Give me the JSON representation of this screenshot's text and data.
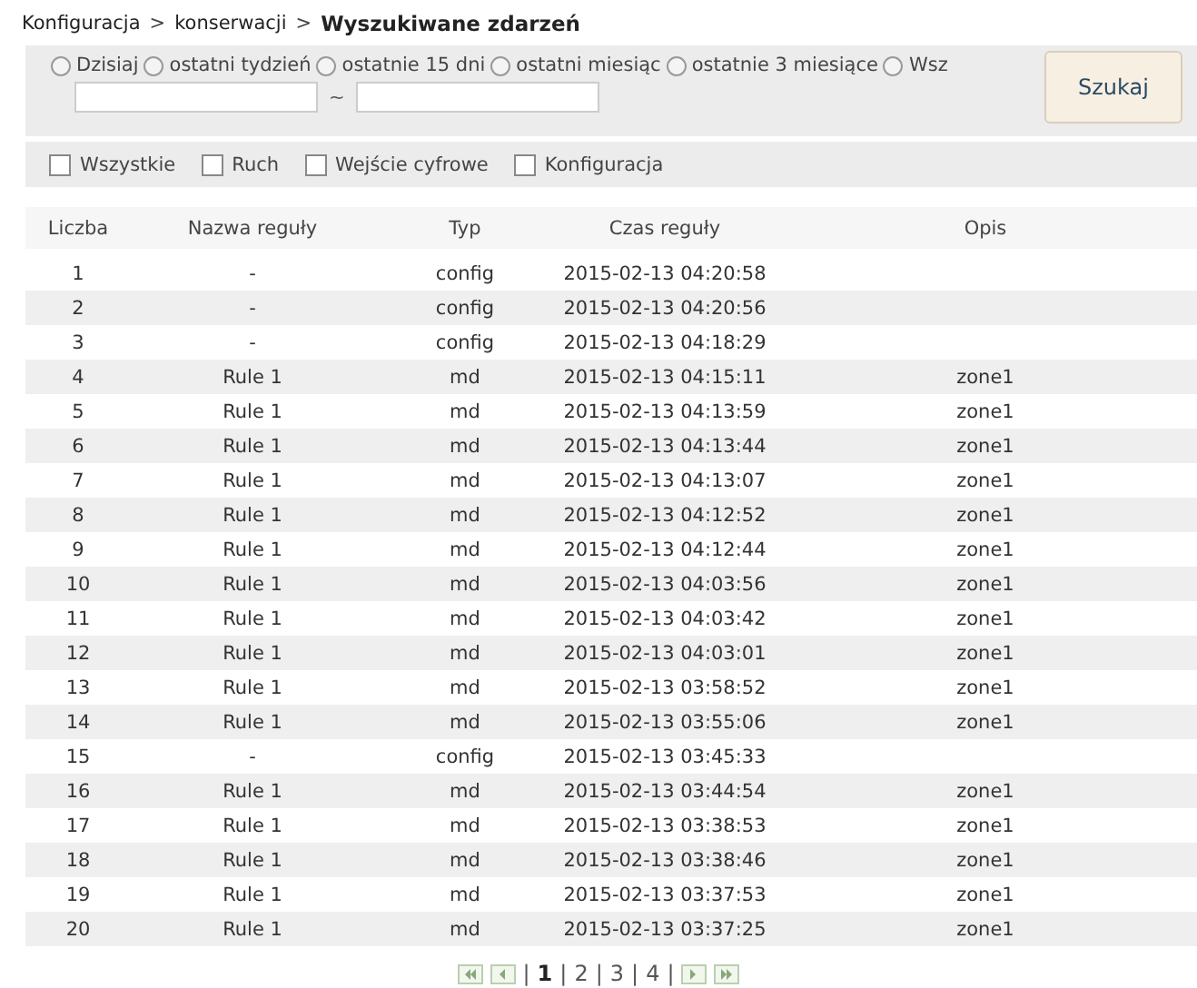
{
  "breadcrumb": [
    {
      "label": "Konfiguracja",
      "current": false
    },
    {
      "kind": "sep",
      "label": ">"
    },
    {
      "label": "konserwacji",
      "current": false
    },
    {
      "kind": "sep",
      "label": ">"
    },
    {
      "label": "Wyszukiwane zdarzeń",
      "current": true
    }
  ],
  "periods": [
    {
      "label": "Dzisiaj",
      "selected": false
    },
    {
      "label": "ostatni tydzień",
      "selected": false
    },
    {
      "label": "ostatnie 15 dni",
      "selected": false
    },
    {
      "label": "ostatni miesiąc",
      "selected": false
    },
    {
      "label": "ostatnie 3 miesiące",
      "selected": false
    },
    {
      "label": "Wsz",
      "selected": false
    }
  ],
  "range_separator": "~",
  "search_button": "Szukaj",
  "filters": [
    {
      "label": "Wszystkie",
      "checked": false
    },
    {
      "label": "Ruch",
      "checked": false
    },
    {
      "label": "Wejście cyfrowe",
      "checked": false
    },
    {
      "label": "Konfiguracja",
      "checked": false
    }
  ],
  "table": {
    "columns": [
      "Liczba",
      "Nazwa reguły",
      "Typ",
      "Czas reguły",
      "Opis"
    ],
    "rows": [
      [
        "1",
        "-",
        "config",
        "2015-02-13 04:20:58",
        ""
      ],
      [
        "2",
        "-",
        "config",
        "2015-02-13 04:20:56",
        ""
      ],
      [
        "3",
        "-",
        "config",
        "2015-02-13 04:18:29",
        ""
      ],
      [
        "4",
        "Rule 1",
        "md",
        "2015-02-13 04:15:11",
        "zone1"
      ],
      [
        "5",
        "Rule 1",
        "md",
        "2015-02-13 04:13:59",
        "zone1"
      ],
      [
        "6",
        "Rule 1",
        "md",
        "2015-02-13 04:13:44",
        "zone1"
      ],
      [
        "7",
        "Rule 1",
        "md",
        "2015-02-13 04:13:07",
        "zone1"
      ],
      [
        "8",
        "Rule 1",
        "md",
        "2015-02-13 04:12:52",
        "zone1"
      ],
      [
        "9",
        "Rule 1",
        "md",
        "2015-02-13 04:12:44",
        "zone1"
      ],
      [
        "10",
        "Rule 1",
        "md",
        "2015-02-13 04:03:56",
        "zone1"
      ],
      [
        "11",
        "Rule 1",
        "md",
        "2015-02-13 04:03:42",
        "zone1"
      ],
      [
        "12",
        "Rule 1",
        "md",
        "2015-02-13 04:03:01",
        "zone1"
      ],
      [
        "13",
        "Rule 1",
        "md",
        "2015-02-13 03:58:52",
        "zone1"
      ],
      [
        "14",
        "Rule 1",
        "md",
        "2015-02-13 03:55:06",
        "zone1"
      ],
      [
        "15",
        "-",
        "config",
        "2015-02-13 03:45:33",
        ""
      ],
      [
        "16",
        "Rule 1",
        "md",
        "2015-02-13 03:44:54",
        "zone1"
      ],
      [
        "17",
        "Rule 1",
        "md",
        "2015-02-13 03:38:53",
        "zone1"
      ],
      [
        "18",
        "Rule 1",
        "md",
        "2015-02-13 03:38:46",
        "zone1"
      ],
      [
        "19",
        "Rule 1",
        "md",
        "2015-02-13 03:37:53",
        "zone1"
      ],
      [
        "20",
        "Rule 1",
        "md",
        "2015-02-13 03:37:25",
        "zone1"
      ]
    ]
  },
  "pager": [
    {
      "kind": "first"
    },
    {
      "kind": "prev"
    },
    {
      "kind": "sep",
      "label": "|"
    },
    {
      "kind": "page",
      "label": "1",
      "selected": true
    },
    {
      "kind": "sep",
      "label": "|"
    },
    {
      "kind": "page",
      "label": "2",
      "selected": false
    },
    {
      "kind": "sep",
      "label": "|"
    },
    {
      "kind": "page",
      "label": "3",
      "selected": false
    },
    {
      "kind": "sep",
      "label": "|"
    },
    {
      "kind": "page",
      "label": "4",
      "selected": false
    },
    {
      "kind": "sep",
      "label": "|"
    },
    {
      "kind": "next"
    },
    {
      "kind": "last"
    }
  ]
}
